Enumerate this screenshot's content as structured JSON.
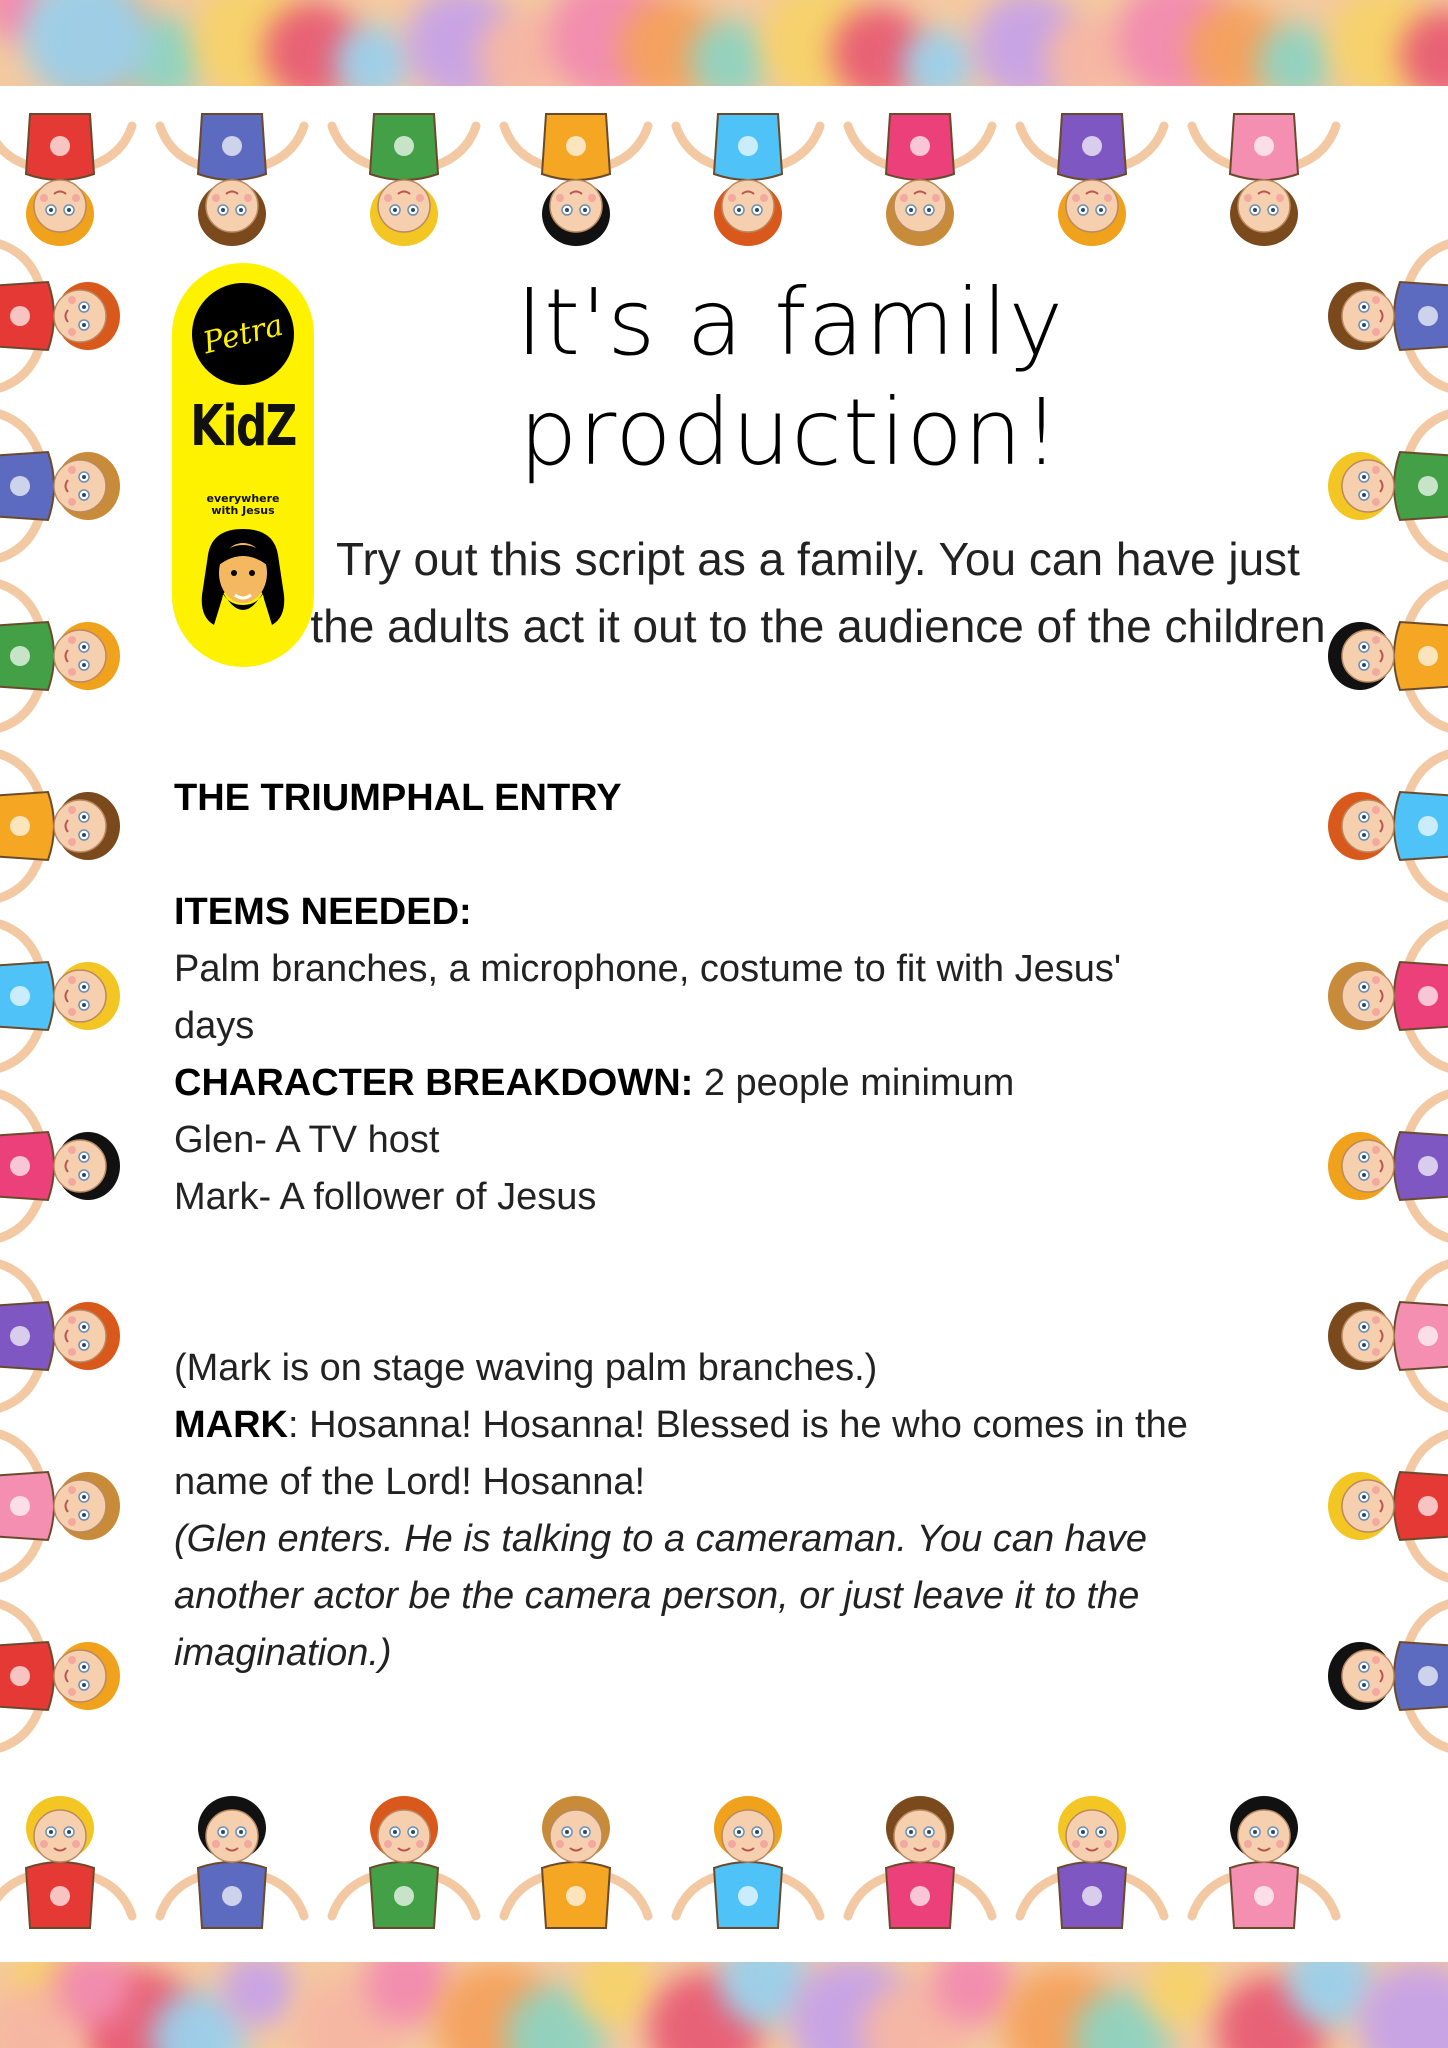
{
  "logo": {
    "script_word": "Petra",
    "brand": "KidZ",
    "tagline": "everywhere\nwith Jesus"
  },
  "title": "It's a family production!",
  "subtitle": "Try out this script as a family. You can have just the adults act it out to the audience of the children",
  "script": {
    "heading": "THE TRIUMPHAL ENTRY",
    "items_label": "ITEMS NEEDED:",
    "items_line1": "Palm branches, a microphone, costume to fit with Jesus'",
    "items_line2": "days",
    "characters_label": "CHARACTER BREAKDOWN:",
    "characters_value": " 2 people minimum",
    "character_1": "Glen- A TV host",
    "character_2": "Mark- A follower of Jesus",
    "stage_direction_1": "(Mark is on stage waving palm branches.)",
    "mark_label": "MARK",
    "mark_line1": ": Hosanna! Hosanna! Blessed is he who comes in the",
    "mark_line2": "name of the Lord! Hosanna!",
    "stage_direction_2_line1": "(Glen enters. He is talking to a cameraman. You can have",
    "stage_direction_2_line2": "another actor be the camera person, or just leave it to the",
    "stage_direction_2_line3": "imagination.)"
  },
  "colors": {
    "logo_yellow": "#fff200",
    "shirt_colors": [
      "#e53935",
      "#5c6bc0",
      "#43a047",
      "#f5a623",
      "#4fc3f7",
      "#ec407a",
      "#7e57c2",
      "#f48fb1"
    ]
  },
  "icons": [
    "kid-illustration-border",
    "jesus-face-icon"
  ]
}
